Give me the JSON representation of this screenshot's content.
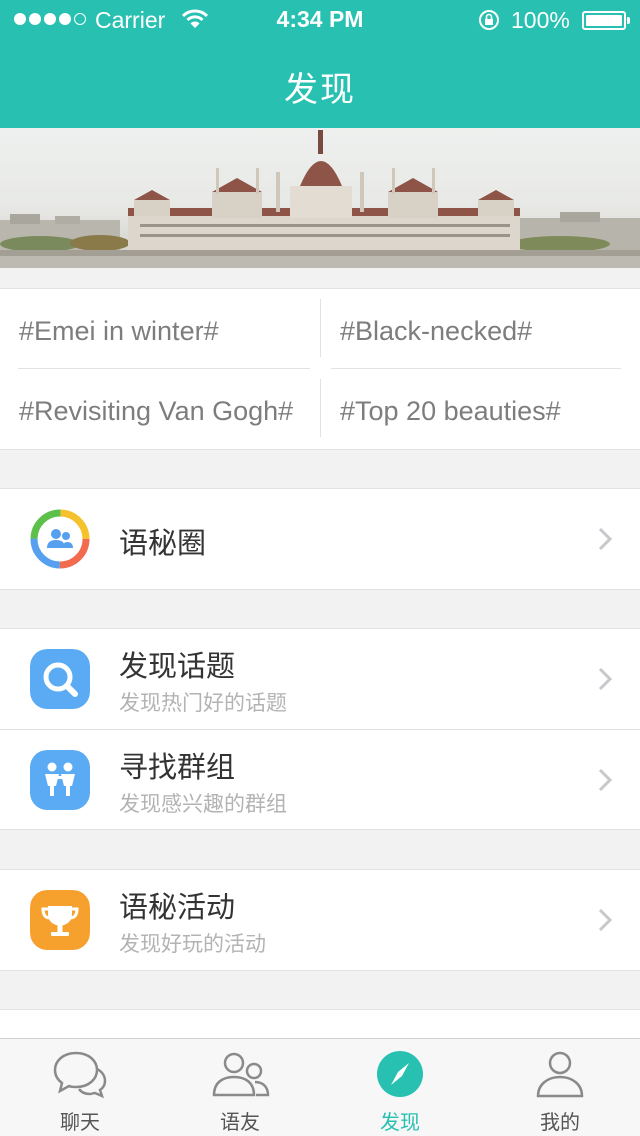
{
  "status_bar": {
    "carrier": "Carrier",
    "time": "4:34 PM",
    "battery": "100%"
  },
  "nav": {
    "title": "发现"
  },
  "topics": [
    "#Emei in winter#",
    "#Black-necked#",
    "#Revisiting Van Gogh#",
    "#Top 20 beauties#"
  ],
  "sections": [
    {
      "rows": [
        {
          "title": "语秘圈",
          "subtitle": "",
          "icon": "circle-contacts-icon"
        }
      ]
    },
    {
      "rows": [
        {
          "title": "发现话题",
          "subtitle": "发现热门好的话题",
          "icon": "search-icon",
          "color": "#5aabf4"
        },
        {
          "title": "寻找群组",
          "subtitle": "发现感兴趣的群组",
          "icon": "people-icon",
          "color": "#5aabf4"
        }
      ]
    },
    {
      "rows": [
        {
          "title": "语秘活动",
          "subtitle": "发现好玩的活动",
          "icon": "trophy-icon",
          "color": "#f6a02d"
        }
      ]
    }
  ],
  "tabs": [
    {
      "label": "聊天",
      "icon": "chat-bubbles-icon",
      "active": false
    },
    {
      "label": "语友",
      "icon": "contacts-icon",
      "active": false
    },
    {
      "label": "发现",
      "icon": "compass-icon",
      "active": true
    },
    {
      "label": "我的",
      "icon": "user-icon",
      "active": false
    }
  ],
  "colors": {
    "accent": "#27c0b1",
    "background": "#f2f2f2",
    "subtitle": "#b3b3b3"
  }
}
